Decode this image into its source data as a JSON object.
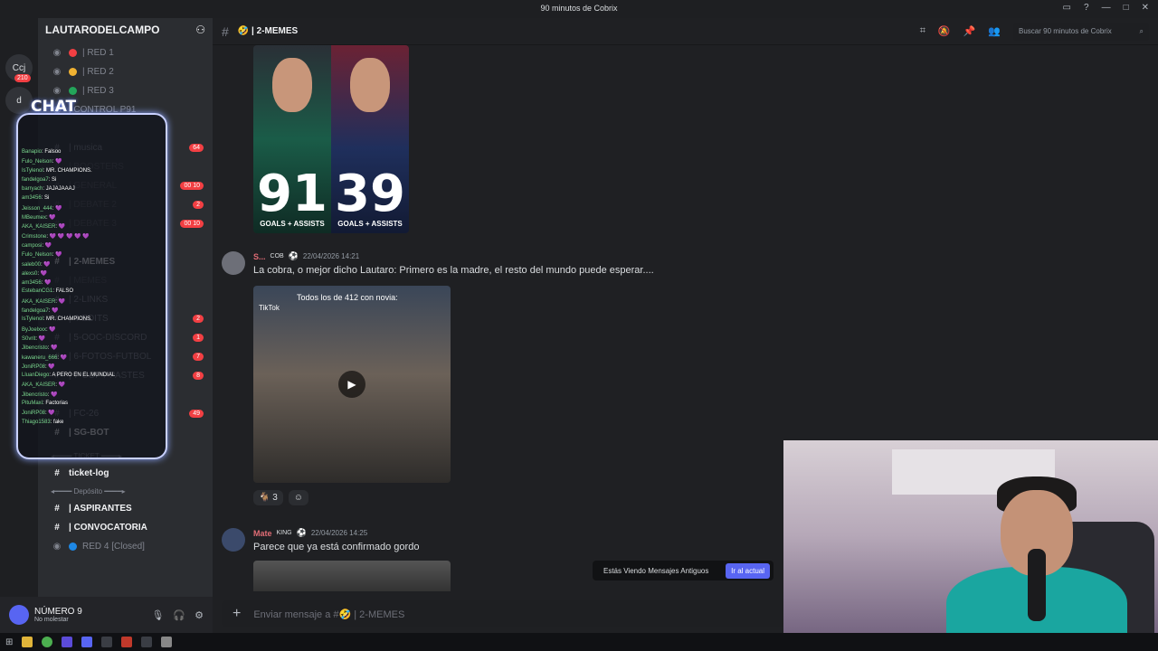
{
  "window": {
    "title": "90 minutos de Cobrix"
  },
  "servers": [
    "Ccj",
    "d"
  ],
  "server_badge": "210",
  "server": {
    "name": "LAUTARODELCAMPO"
  },
  "channels": [
    {
      "label": "| RED 1",
      "icon": "voice",
      "color": "#f23f43",
      "style": "normal"
    },
    {
      "label": "| RED 2",
      "icon": "voice",
      "color": "#f0b232",
      "style": "normal"
    },
    {
      "label": "| RED 3",
      "icon": "voice",
      "color": "#23a55a",
      "style": "normal"
    },
    {
      "label": "| CONTROL P91",
      "icon": "voice",
      "color": "",
      "style": "normal"
    },
    {
      "label": "",
      "icon": "",
      "color": "",
      "style": "dim"
    },
    {
      "label": "| musica",
      "icon": "hash",
      "badge": "64",
      "style": "normal"
    },
    {
      "label": "| BOOSTERS",
      "icon": "hash",
      "style": "dim"
    },
    {
      "label": "| GENERAL",
      "icon": "hash",
      "badge": "00 10",
      "style": "dim"
    },
    {
      "label": "| DEBATE 2",
      "icon": "hash",
      "badge": "2",
      "style": "dim"
    },
    {
      "label": "| DEBATE 3",
      "icon": "hash",
      "badge": "00 10",
      "style": "dim"
    },
    {
      "label": "",
      "icon": "",
      "style": "dim"
    },
    {
      "label": "| 2-MEMES",
      "icon": "hash",
      "style": "bright"
    },
    {
      "label": "| MEMES",
      "icon": "hash",
      "style": "dim"
    },
    {
      "label": "| 2-LINKS",
      "icon": "hash",
      "style": "normal"
    },
    {
      "label": "| 4-EDITS",
      "icon": "hash",
      "badge": "2",
      "style": "normal"
    },
    {
      "label": "| 5-OOC-DISCORD",
      "icon": "hash",
      "badge": "1",
      "style": "normal"
    },
    {
      "label": "| 6-FOTOS-FUTBOL",
      "icon": "hash",
      "badge": "7",
      "style": "normal"
    },
    {
      "label": "| 7-COPY-PASTES",
      "icon": "hash",
      "badge": "8",
      "style": "normal"
    },
    {
      "label": "",
      "icon": "",
      "style": "dim"
    },
    {
      "label": "| FC-26",
      "icon": "hash",
      "badge": "49",
      "style": "normal"
    },
    {
      "label": "| SG-BOT",
      "icon": "hash",
      "style": "bright"
    }
  ],
  "categories": {
    "ticket": "◂━━━━ TICKET ━━━━▸",
    "deposito": "◂━━━━ Depósito ━━━━▸"
  },
  "lower_channels": [
    {
      "label": "ticket-log",
      "icon": "hash"
    },
    {
      "label": "| ASPIRANTES",
      "icon": "hash"
    },
    {
      "label": "| CONVOCATORIA",
      "icon": "hash"
    },
    {
      "label": "RED 4 [Closed]",
      "icon": "voice"
    }
  ],
  "user": {
    "name": "NÚMERO 9",
    "status": "No molestar"
  },
  "channel": {
    "name": "| 2-MEMES"
  },
  "header": {
    "search_placeholder": "Buscar 90 minutos de Cobrix"
  },
  "image1": {
    "left_number": "91",
    "right_number": "39",
    "caption": "GOALS + ASSISTS"
  },
  "message1": {
    "author": "S...",
    "tag": "COB",
    "time": "22/04/2026 14:21",
    "text": "La cobra, o mejor dicho Lautaro: Primero es la madre, el resto del mundo puede esperar....",
    "video_caption": "Todos los de 412 con novia:",
    "video_watermark": "TikTok",
    "reaction_count": "3"
  },
  "message2": {
    "author": "Mate",
    "tag": "KING",
    "time": "22/04/2026 14:25",
    "text": "Parece que ya está confirmado gordo"
  },
  "old_messages": {
    "text": "Estás Viendo Mensajes Antiguos",
    "button": "Ir al actual"
  },
  "composer": {
    "placeholder": "Enviar mensaje a #🤣 | 2-MEMES"
  },
  "overlay": {
    "chat_label": "CHAT",
    "lines": [
      {
        "user": "Banapio",
        "msg": ": Falsoo"
      },
      {
        "user": "Fulo_Nelson",
        "msg": ": 💜"
      },
      {
        "user": "IsTylenol",
        "msg": ": MR. CHAMPIONS."
      },
      {
        "user": "fandelgoa7",
        "msg": ": Si"
      },
      {
        "user": "barryach",
        "msg": ": JAJAJAAAJ"
      },
      {
        "user": "am3456",
        "msg": ": Si"
      },
      {
        "user": "Jeisson_444",
        "msg": ": 💜"
      },
      {
        "user": "MBeumex",
        "msg": ": 💜"
      },
      {
        "user": "AKA_KAISER",
        "msg": ": 💜"
      },
      {
        "user": "Crimstone",
        "msg": ": 💜 💜 💜 💜 💜"
      },
      {
        "user": "camposi",
        "msg": ": 💜"
      },
      {
        "user": "Fulo_Nelson",
        "msg": ": 💜"
      },
      {
        "user": "saleb00",
        "msg": ": 💜"
      },
      {
        "user": "alexs0",
        "msg": ": 💜"
      },
      {
        "user": "am3456",
        "msg": ": 💜"
      },
      {
        "user": "EstebanCG1",
        "msg": ": FALSO"
      },
      {
        "user": "AKA_KAISER",
        "msg": ": 💜"
      },
      {
        "user": "fandelgoa7",
        "msg": ": 💜"
      },
      {
        "user": "IsTylenol",
        "msg": ": MR. CHAMPIONS."
      },
      {
        "user": "ByJoelxxx",
        "msg": ": 💜"
      },
      {
        "user": "S0vrit",
        "msg": ": 💜"
      },
      {
        "user": "Jibencristo",
        "msg": ": 💜"
      },
      {
        "user": "kawaneru_666",
        "msg": ": 💜"
      },
      {
        "user": "JoniRP08",
        "msg": ": 💜"
      },
      {
        "user": "LluanDiego",
        "msg": ": A PERO EN EL MUNDIAL"
      },
      {
        "user": "AKA_KAISER",
        "msg": ": 💜"
      },
      {
        "user": "Jibencristo",
        "msg": ": 💜"
      },
      {
        "user": "PituMaxi",
        "msg": ": Factorias"
      },
      {
        "user": "JoniRP08",
        "msg": ": 💜"
      },
      {
        "user": "Thiago1583",
        "msg": ": fake"
      }
    ]
  }
}
